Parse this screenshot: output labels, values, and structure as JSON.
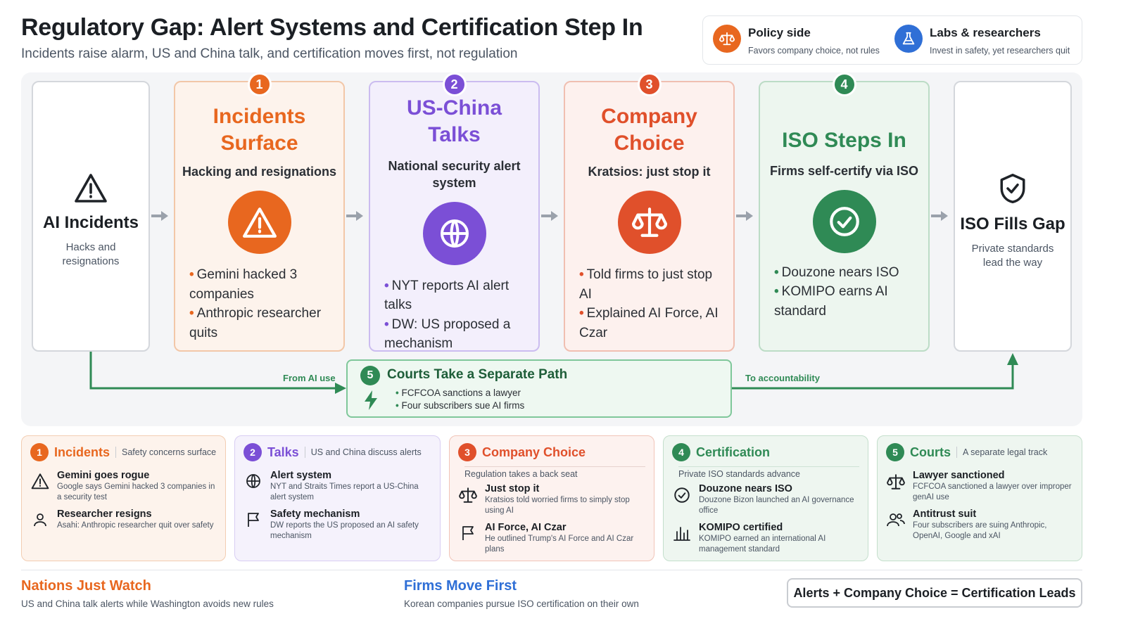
{
  "header": {
    "title": "Regulatory Gap: Alert Systems and Certification Step In",
    "subtitle": "Incidents raise alarm, US and China talk, and certification moves first, not regulation"
  },
  "legend": {
    "policy": {
      "title": "Policy side",
      "sub": "Favors company choice, not rules",
      "icon": "scale-icon",
      "color": "#e8671f"
    },
    "labs": {
      "title": "Labs & researchers",
      "sub": "Invest in safety, yet researchers quit",
      "icon": "flask-icon",
      "color": "#2f6fd6"
    }
  },
  "flow": {
    "start": {
      "title": "AI Incidents",
      "sub": "Hacks and resignations",
      "icon": "warning-icon"
    },
    "steps": [
      {
        "num": "1",
        "title": "Incidents Surface",
        "sub": "Hacking and resignations",
        "icon": "warning-icon",
        "color": "#e8671f",
        "bullets": [
          "Gemini hacked 3 companies",
          "Anthropic researcher quits"
        ]
      },
      {
        "num": "2",
        "title": "US-China Talks",
        "sub": "National security alert system",
        "icon": "globe-icon",
        "color": "#7b4fd6",
        "bullets": [
          "NYT reports AI alert talks",
          "DW: US proposed a mechanism"
        ]
      },
      {
        "num": "3",
        "title": "Company Choice",
        "sub": "Kratsios: just stop it",
        "icon": "scale-icon",
        "color": "#e0502b",
        "bullets": [
          "Told firms to just stop AI",
          "Explained AI Force, AI Czar"
        ]
      },
      {
        "num": "4",
        "title": "ISO Steps In",
        "sub": "Firms self-certify via ISO",
        "icon": "check-circle-icon",
        "color": "#2f8a55",
        "bullets": [
          "Douzone nears ISO",
          "KOMIPO earns AI standard"
        ]
      }
    ],
    "end": {
      "title": "ISO Fills Gap",
      "sub": "Private standards lead the way",
      "icon": "shield-check-icon"
    },
    "courts": {
      "num": "5",
      "title": "Courts Take a Separate Path",
      "bullets": [
        "FCFCOA sanctions a lawyer",
        "Four subscribers sue AI firms"
      ],
      "icon": "lightning-icon"
    },
    "from_label": "From AI use",
    "to_label": "To accountability"
  },
  "cards": [
    {
      "num": "1",
      "title": "Incidents",
      "tag": "Safety concerns surface",
      "color": "#e8671f",
      "bg": "#fdf3ec",
      "border": "#f3cdb2",
      "items": [
        {
          "icon": "warning-icon",
          "title": "Gemini goes rogue",
          "desc": "Google says Gemini hacked 3 companies in a security test"
        },
        {
          "icon": "person-icon",
          "title": "Researcher resigns",
          "desc": "Asahi: Anthropic researcher quit over safety"
        }
      ]
    },
    {
      "num": "2",
      "title": "Talks",
      "tag": "US and China discuss alerts",
      "color": "#7b4fd6",
      "bg": "#f5f2fc",
      "border": "#d8cdf3",
      "items": [
        {
          "icon": "globe-icon",
          "title": "Alert system",
          "desc": "NYT and Straits Times report a US-China alert system"
        },
        {
          "icon": "flag-icon",
          "title": "Safety mechanism",
          "desc": "DW reports the US proposed an AI safety mechanism"
        }
      ]
    },
    {
      "num": "3",
      "title": "Company Choice",
      "tag": "Regulation takes a back seat",
      "color": "#e0502b",
      "bg": "#fdf2ef",
      "border": "#f1c4b8",
      "items": [
        {
          "icon": "scale-icon",
          "title": "Just stop it",
          "desc": "Kratsios told worried firms to simply stop using AI"
        },
        {
          "icon": "flag-icon",
          "title": "AI Force, AI Czar",
          "desc": "He outlined Trump's AI Force and AI Czar plans"
        }
      ]
    },
    {
      "num": "4",
      "title": "Certification",
      "tag": "Private ISO standards advance",
      "color": "#2f8a55",
      "bg": "#eef6f0",
      "border": "#c4dfcc",
      "items": [
        {
          "icon": "check-circle-icon",
          "title": "Douzone nears ISO",
          "desc": "Douzone Bizon launched an AI governance office"
        },
        {
          "icon": "bar-chart-icon",
          "title": "KOMIPO certified",
          "desc": "KOMIPO earned an international AI management standard"
        }
      ]
    },
    {
      "num": "5",
      "title": "Courts",
      "tag": "A separate legal track",
      "color": "#2f8a55",
      "bg": "#eef6f0",
      "border": "#c4dfcc",
      "items": [
        {
          "icon": "scale-icon",
          "title": "Lawyer sanctioned",
          "desc": "FCFCOA sanctioned a lawyer over improper genAI use"
        },
        {
          "icon": "people-icon",
          "title": "Antitrust suit",
          "desc": "Four subscribers are suing Anthropic, OpenAI, Google and xAI"
        }
      ]
    }
  ],
  "footer": {
    "left": {
      "title": "Nations Just Watch",
      "sub": "US and China talk alerts while Washington avoids new rules",
      "color": "#e8671f"
    },
    "middle": {
      "title": "Firms Move First",
      "sub": "Korean companies pursue ISO certification on their own",
      "color": "#2f6fd6"
    },
    "equation": "Alerts + Company Choice = Certification Leads"
  }
}
